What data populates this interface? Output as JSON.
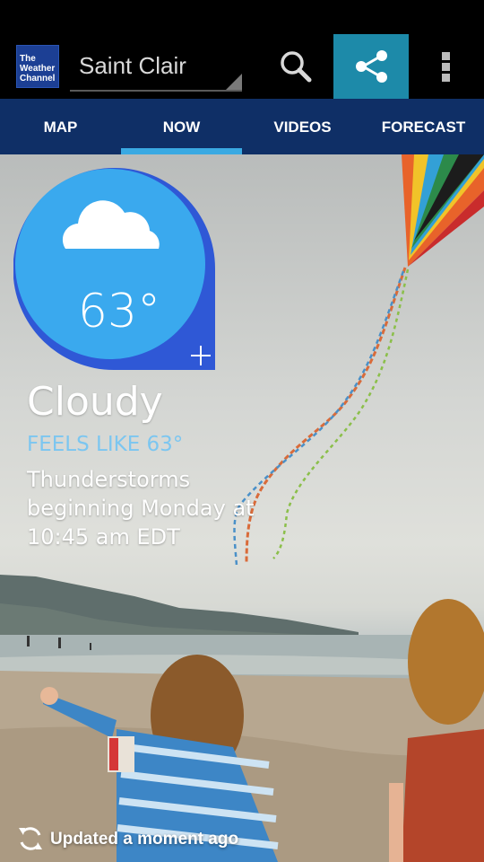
{
  "app": {
    "logo_lines": [
      "The",
      "Weather",
      "Channel"
    ],
    "location": "Saint Clair"
  },
  "toolbar": {
    "search_icon": "search-icon",
    "share_icon": "share-icon",
    "overflow_icon": "overflow-menu-icon",
    "accent_color": "#1d8aa9"
  },
  "tabs": [
    {
      "label": "MAP",
      "selected": false
    },
    {
      "label": "NOW",
      "selected": true
    },
    {
      "label": "VIDEOS",
      "selected": false
    },
    {
      "label": "FORECAST",
      "selected": false
    }
  ],
  "current": {
    "temperature": "63°",
    "condition": "Cloudy",
    "feels_like": "FEELS LIKE 63°",
    "alert": "Thunderstorms beginning Monday at 10:45 am EDT",
    "condition_icon": "cloud-icon",
    "badge_color": "#3aa9ee"
  },
  "footer": {
    "updated": "Updated a moment ago"
  }
}
